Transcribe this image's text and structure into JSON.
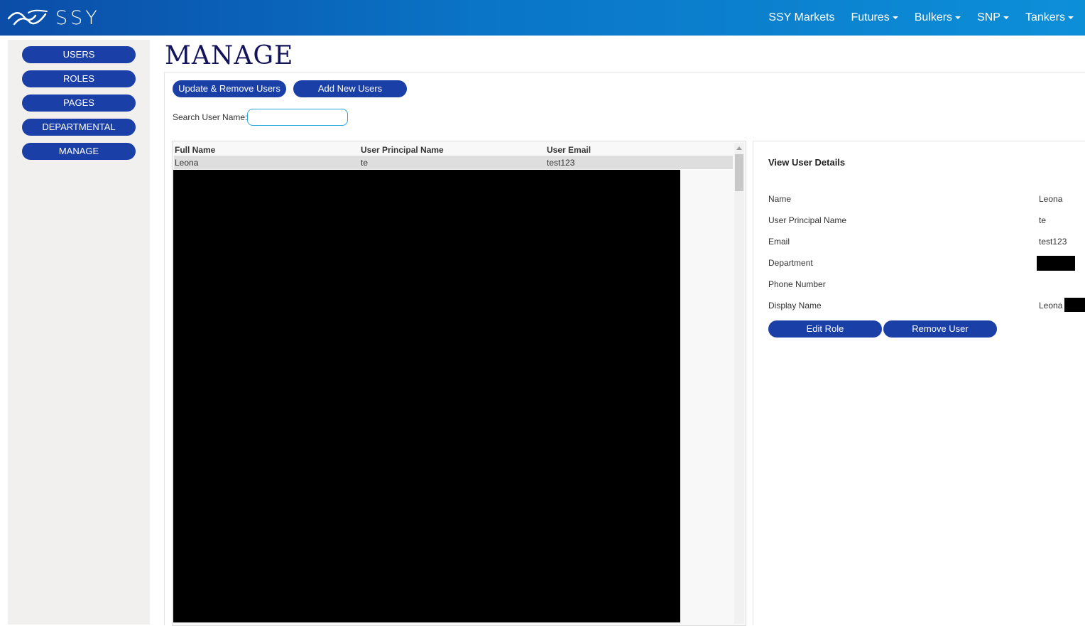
{
  "header": {
    "logo_text": "SSY",
    "nav": [
      {
        "label": "SSY Markets",
        "has_dropdown": false
      },
      {
        "label": "Futures",
        "has_dropdown": true
      },
      {
        "label": "Bulkers",
        "has_dropdown": true
      },
      {
        "label": "SNP",
        "has_dropdown": true
      },
      {
        "label": "Tankers",
        "has_dropdown": true
      }
    ]
  },
  "sidebar": {
    "items": [
      {
        "label": "USERS"
      },
      {
        "label": "ROLES"
      },
      {
        "label": "PAGES"
      },
      {
        "label": "DEPARTMENTAL"
      },
      {
        "label": "MANAGE"
      }
    ]
  },
  "main": {
    "title": "MANAGE",
    "update_remove_label": "Update & Remove Users",
    "add_new_label": "Add New Users",
    "search_label": "Search User Name:",
    "search_value": ""
  },
  "grid": {
    "columns": [
      "Full Name",
      "User Principal Name",
      "User Email"
    ],
    "rows": [
      {
        "full_name": "Leona",
        "upn": "te",
        "email": "test123"
      }
    ]
  },
  "details": {
    "title": "View User Details",
    "fields": [
      {
        "label": "Name",
        "value": "Leona"
      },
      {
        "label": "User Principal Name",
        "value": "te"
      },
      {
        "label": "Email",
        "value": "test123"
      },
      {
        "label": "Department",
        "value": ""
      },
      {
        "label": "Phone Number",
        "value": ""
      },
      {
        "label": "Display Name",
        "value": "Leona"
      }
    ],
    "edit_role_label": "Edit Role",
    "remove_user_label": "Remove User"
  },
  "colors": {
    "header_start": "#0b4da8",
    "header_end": "#0d8fd8",
    "button": "#1a3fa6",
    "title": "#14145a",
    "search_border": "#2aa6df"
  }
}
